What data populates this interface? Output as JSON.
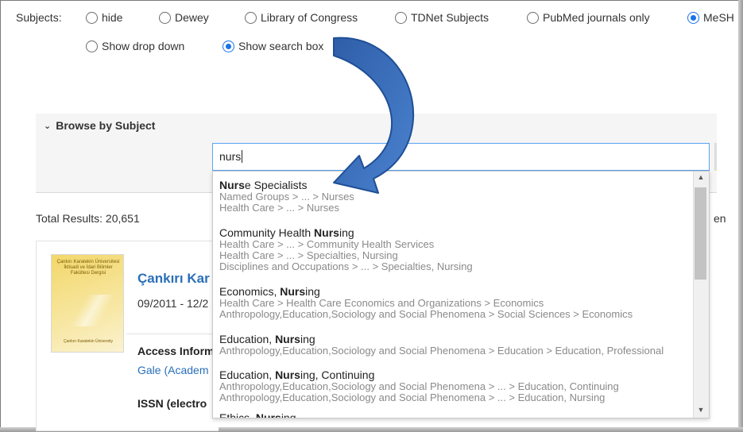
{
  "subjects": {
    "label": "Subjects:",
    "options": [
      "hide",
      "Dewey",
      "Library of Congress",
      "TDNet Subjects",
      "PubMed journals only",
      "MeSH"
    ],
    "selected": "MeSH",
    "display_options": [
      "Show drop down",
      "Show search box"
    ],
    "display_selected": "Show search box"
  },
  "browse": {
    "heading": "Browse by Subject",
    "search_value": "nurs"
  },
  "results": {
    "total": "Total Results: 20,651",
    "cut_right": "en",
    "item": {
      "title": "Çankırı Kar",
      "date": "09/2011 - 12/2",
      "access": "Access Inform",
      "provider": "Gale (Academ",
      "issn": "ISSN (electro",
      "cover_title": "Çankırı Karatekin Üniversitesi İktisadi ve İdari Bilimler Fakültesi Dergisi",
      "cover_foot": "Çankırı Karatekin Üniversity"
    }
  },
  "suggestions": [
    {
      "pre": "",
      "bold": "Nurs",
      "post": "e Specialists",
      "paths": [
        "Named Groups > ... > Nurses",
        "Health Care > ... > Nurses"
      ]
    },
    {
      "pre": "Community Health ",
      "bold": "Nurs",
      "post": "ing",
      "paths": [
        "Health Care > ... > Community Health Services",
        "Health Care > ... > Specialties, Nursing",
        "Disciplines and Occupations > ... > Specialties, Nursing"
      ]
    },
    {
      "pre": "Economics, ",
      "bold": "Nurs",
      "post": "ing",
      "paths": [
        "Health Care > Health Care Economics and Organizations > Economics",
        "Anthropology,Education,Sociology and Social Phenomena > Social Sciences > Economics"
      ]
    },
    {
      "pre": "Education, ",
      "bold": "Nurs",
      "post": "ing",
      "paths": [
        "Anthropology,Education,Sociology and Social Phenomena > Education > Education, Professional"
      ]
    },
    {
      "pre": "Education, ",
      "bold": "Nurs",
      "post": "ing, Continuing",
      "paths": [
        "Anthropology,Education,Sociology and Social Phenomena > ... > Education, Continuing",
        "Anthropology,Education,Sociology and Social Phenomena > ... > Education, Nursing"
      ]
    },
    {
      "pre": "Ethics, ",
      "bold": "Nurs",
      "post": "ing",
      "paths": []
    }
  ],
  "icons": {
    "collapse": "chevron-down-icon",
    "scroll_up": "scroll-up-arrow-icon",
    "scroll_down": "scroll-down-arrow-icon",
    "annotation_arrow": "curved-arrow-icon"
  },
  "colors": {
    "accent": "#1a73e8",
    "link": "#2a6fb8",
    "arrow": "#3a6fbf"
  }
}
